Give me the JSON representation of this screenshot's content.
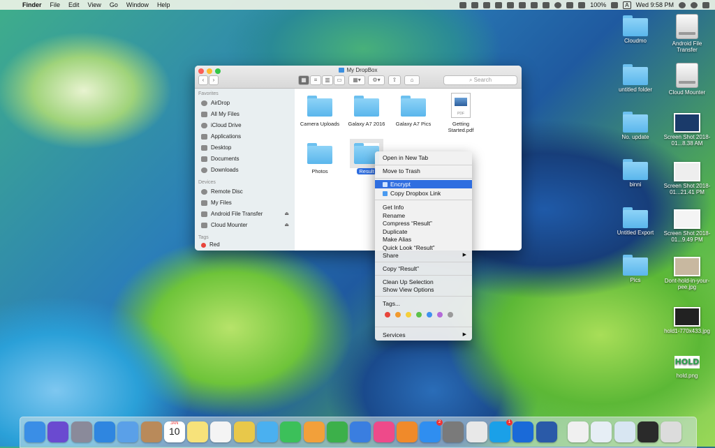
{
  "menubar": {
    "apple": "",
    "items": [
      "Finder",
      "File",
      "Edit",
      "View",
      "Go",
      "Window",
      "Help"
    ],
    "battery": "100%",
    "clock": "Wed 9:58 PM",
    "input_source": "A"
  },
  "desktop": {
    "icons": [
      {
        "label": "Cloudmo",
        "kind": "folder"
      },
      {
        "label": "Android File Transfer",
        "kind": "drive"
      },
      {
        "label": "untitled folder",
        "kind": "folder"
      },
      {
        "label": "Cloud Mounter",
        "kind": "drive"
      },
      {
        "label": "No. update",
        "kind": "folder"
      },
      {
        "label": "Screen Shot 2018-01...8.38 AM",
        "kind": "shot"
      },
      {
        "label": "binni",
        "kind": "folder"
      },
      {
        "label": "Screen Shot 2018-01...21.41 PM",
        "kind": "shot"
      },
      {
        "label": "Untitled Export",
        "kind": "folder"
      },
      {
        "label": "Screen Shot 2018-01...9.49 PM",
        "kind": "shot"
      },
      {
        "label": "Pics",
        "kind": "folder"
      },
      {
        "label": "Dont-hold-in-your-pee.jpg",
        "kind": "shot"
      },
      {
        "label": "hold1-770x433.jpg",
        "kind": "shot"
      },
      {
        "label": "hold.png",
        "kind": "hold"
      }
    ],
    "hold_logo_text": "HOLD"
  },
  "finder": {
    "title": "My DropBox",
    "search_placeholder": "Search",
    "sidebar": {
      "favorites_header": "Favorites",
      "favorites": [
        "AirDrop",
        "All My Files",
        "iCloud Drive",
        "Applications",
        "Desktop",
        "Documents",
        "Downloads"
      ],
      "devices_header": "Devices",
      "devices": [
        "Remote Disc",
        "My Files",
        "Android File Transfer",
        "Cloud Mounter"
      ],
      "eject": "⏏",
      "tags_header": "Tags",
      "tags": [
        "Red"
      ]
    },
    "files": [
      {
        "name": "Camera Uploads",
        "kind": "folder"
      },
      {
        "name": "Galaxy A7 2016",
        "kind": "folder"
      },
      {
        "name": "Galaxy A7 Pics",
        "kind": "folder"
      },
      {
        "name": "Getting Started.pdf",
        "kind": "pdf"
      },
      {
        "name": "Photos",
        "kind": "folder"
      },
      {
        "name": "Result",
        "kind": "folder",
        "selected": true
      }
    ],
    "pdf_label": "PDF"
  },
  "context_menu": {
    "items": {
      "open_new_tab": "Open in New Tab",
      "move_trash": "Move to Trash",
      "encrypt": "Encrypt",
      "copy_dropbox_link": "Copy Dropbox Link",
      "get_info": "Get Info",
      "rename": "Rename",
      "compress": "Compress “Result”",
      "duplicate": "Duplicate",
      "make_alias": "Make Alias",
      "quick_look": "Quick Look “Result”",
      "share": "Share",
      "copy": "Copy “Result”",
      "clean_up": "Clean Up Selection",
      "show_view_options": "Show View Options",
      "tags": "Tags...",
      "services": "Services"
    },
    "submenu_arrow": "▶",
    "tag_colors": [
      "#e8453c",
      "#f29a2e",
      "#f5cf3a",
      "#5cc14a",
      "#3e90f0",
      "#b46ad8",
      "#9a9a9a"
    ]
  },
  "dock": {
    "calendar_day": "10",
    "calendar_month": "JAN",
    "badges": {
      "app_store": "2",
      "skype": "1"
    },
    "apps": [
      {
        "name": "finder",
        "color": "#3a8ee6"
      },
      {
        "name": "siri",
        "color": "#6a4ad0"
      },
      {
        "name": "launchpad",
        "color": "#8a8a9a"
      },
      {
        "name": "safari",
        "color": "#2f86e0"
      },
      {
        "name": "mail",
        "color": "#5aa0e8"
      },
      {
        "name": "contacts",
        "color": "#b98a5a"
      },
      {
        "name": "calendar",
        "color": "#ffffff"
      },
      {
        "name": "notes",
        "color": "#f7e27a"
      },
      {
        "name": "reminders",
        "color": "#f4f4f4"
      },
      {
        "name": "photos",
        "color": "#e8c84a"
      },
      {
        "name": "messages",
        "color": "#4ab0f0"
      },
      {
        "name": "facetime",
        "color": "#3cc05a"
      },
      {
        "name": "pages",
        "color": "#f2a03a"
      },
      {
        "name": "numbers",
        "color": "#3cb04a"
      },
      {
        "name": "keynote",
        "color": "#3a7ee0"
      },
      {
        "name": "itunes",
        "color": "#ee4a8a"
      },
      {
        "name": "ibooks",
        "color": "#f08a2a"
      },
      {
        "name": "app-store",
        "color": "#2f8ef0"
      },
      {
        "name": "system-preferences",
        "color": "#7a7a7a"
      },
      {
        "name": "chrome",
        "color": "#e8e8e8"
      },
      {
        "name": "skype",
        "color": "#1aa0e8"
      },
      {
        "name": "teamviewer",
        "color": "#1a6ad8"
      },
      {
        "name": "word",
        "color": "#2a5aa8"
      },
      {
        "name": "document",
        "color": "#f0f0f0"
      },
      {
        "name": "stack-1",
        "color": "#e6eef5"
      },
      {
        "name": "stack-2",
        "color": "#d8e6f2"
      },
      {
        "name": "stack-3",
        "color": "#2a2a2a"
      },
      {
        "name": "trash",
        "color": "#dcdcdc"
      }
    ]
  }
}
